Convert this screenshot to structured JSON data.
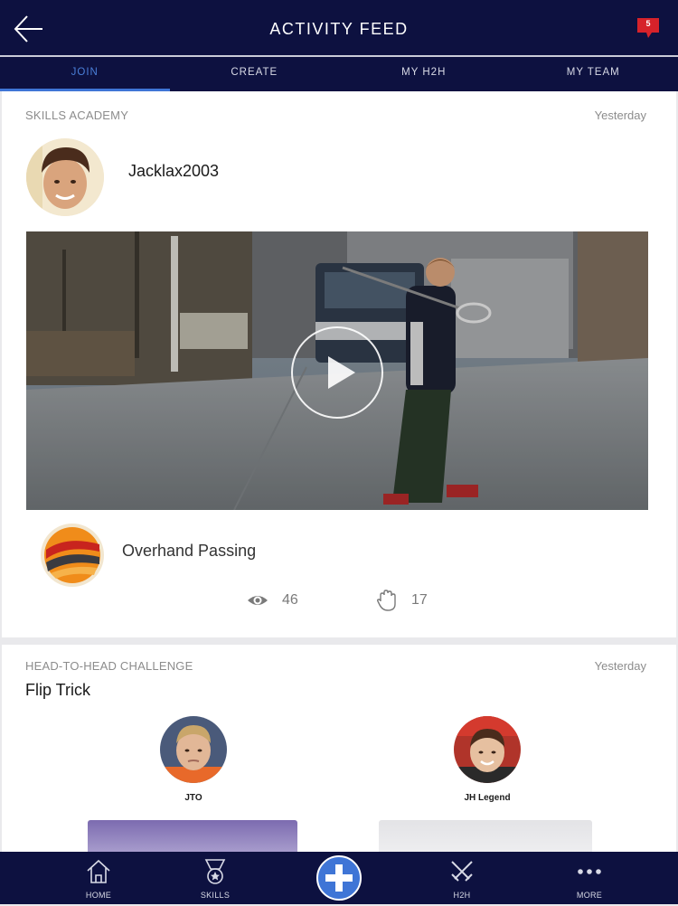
{
  "header": {
    "title": "ACTIVITY FEED",
    "notification_count": "5"
  },
  "tabs": [
    {
      "label": "JOIN",
      "active": true
    },
    {
      "label": "CREATE",
      "active": false
    },
    {
      "label": "MY H2H",
      "active": false
    },
    {
      "label": "MY TEAM",
      "active": false
    }
  ],
  "feed": [
    {
      "category": "SKILLS ACADEMY",
      "time": "Yesterday",
      "username": "Jacklax2003",
      "drill_name": "Overhand Passing",
      "views": "46",
      "hands": "17"
    },
    {
      "category": "HEAD-TO-HEAD CHALLENGE",
      "time": "Yesterday",
      "title": "Flip Trick",
      "competitors": [
        {
          "name": "JTO"
        },
        {
          "name": "JH Legend"
        }
      ]
    }
  ],
  "bottom_nav": {
    "home": "HOME",
    "skills": "SKILLS",
    "h2h": "H2H",
    "more": "MORE"
  },
  "colors": {
    "nav_bg": "#0d1140",
    "accent_blue": "#3f75d6",
    "notification_red": "#d6222a"
  }
}
